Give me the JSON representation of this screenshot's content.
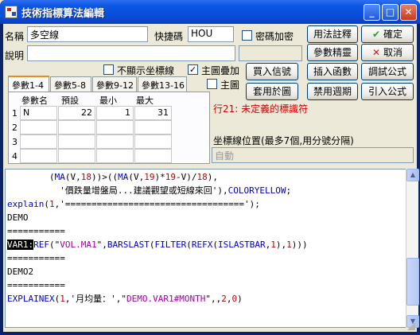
{
  "window": {
    "title": "技術指標算法編輯"
  },
  "titlebar_buttons": {
    "minimize": "_",
    "maximize": "□",
    "close": "✕"
  },
  "form": {
    "name_label": "名稱",
    "name_value": "多空線",
    "hotkey_label": "快捷碼",
    "hotkey_value": "HOU",
    "encrypt_label": "密碼加密",
    "desc_label": "說明",
    "desc_value": "",
    "hide_axis_label": "不顯示坐標線",
    "main_overlay_label": "主圖疊加",
    "main_overlay_checked": "✓",
    "main_label": "主圖"
  },
  "buttons": {
    "syntax_help": "用法註釋",
    "param_tune": "參數精靈",
    "insert_func": "插入函數",
    "confirm": "確定",
    "cancel": "取消",
    "test_formula": "調試公式",
    "buy_sell": "買入信號",
    "use_chart": "套用於圖",
    "disable_period": "禁用週期",
    "import_formula": "引入公式",
    "confirm_icon": "✔",
    "cancel_icon": "✕"
  },
  "tabs": [
    {
      "label": "參數1-4"
    },
    {
      "label": "參數5-8"
    },
    {
      "label": "參數9-12"
    },
    {
      "label": "參數13-16"
    }
  ],
  "param_table": {
    "headers": [
      "參數名",
      "預設",
      "最小",
      "最大"
    ],
    "rows": [
      {
        "no": "1",
        "name": "N",
        "default": "22",
        "min": "1",
        "max": "31"
      },
      {
        "no": "2",
        "name": "",
        "default": "",
        "min": "",
        "max": ""
      },
      {
        "no": "3",
        "name": "",
        "default": "",
        "min": "",
        "max": ""
      },
      {
        "no": "4",
        "name": "",
        "default": "",
        "min": "",
        "max": ""
      }
    ]
  },
  "error_message": "行21: 未定義的標識符",
  "axis_position": {
    "label": "坐標線位置(最多7個,用分號分隔)",
    "value": "自動"
  },
  "code": {
    "l1a": "        (",
    "l1b": "MA",
    "l1c": "(V,",
    "l1d": "18",
    "l1e": "))>((",
    "l1f": "MA",
    "l1g": "(V,",
    "l1h": "19",
    "l1i": ")*",
    "l1j": "19",
    "l1k": "-V)/",
    "l1l": "18",
    "l1m": "),",
    "l2a": "          '價跌量增盤局...建議觀望或短線來回'),",
    "l2b": "COLORYELLOW",
    "l2c": ";",
    "l3a": "explain",
    "l3b": "(",
    "l3c": "1",
    "l3d": ",'",
    "l3e": "==================================",
    "l3f": "');",
    "l4": "DEMO",
    "l5": "===========",
    "l6a": "VAR1:",
    "l6b": "REF",
    "l6c": "(\"",
    "l6d": "VOL.MA1",
    "l6e": "\",",
    "l6f": "BARSLAST",
    "l6g": "(",
    "l6h": "FILTER",
    "l6i": "(",
    "l6j": "REFX",
    "l6k": "(",
    "l6l": "ISLASTBAR",
    "l6m": ",",
    "l6n": "1",
    "l6o": "),",
    "l6p": "1",
    "l6q": ")))",
    "l7": "===========",
    "l8": "DEMO2",
    "l9": "===========",
    "l10a": "EXPLAINEX",
    "l10b": "(",
    "l10c": "1",
    "l10d": ",'月均量：',\"",
    "l10e": "DEMO.VAR1#MONTH",
    "l10f": "\",,",
    "l10g": "2",
    "l10h": ",",
    "l10i": "0",
    "l10j": ")"
  },
  "colors": {
    "titlebar": "#0b56e4",
    "error_text": "#d00000",
    "keyword": "#0000c0",
    "string": "#c00000"
  }
}
